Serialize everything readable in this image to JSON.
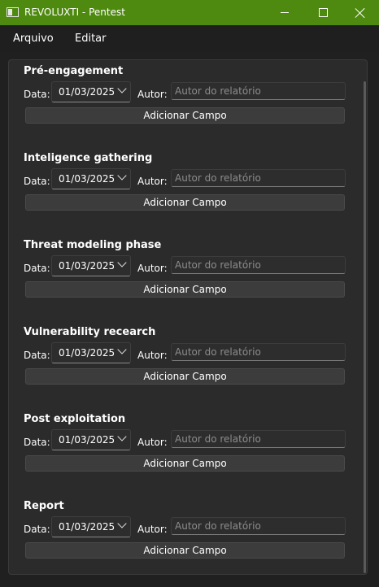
{
  "window": {
    "title": "REVOLUXTI - Pentest",
    "titlebar_color": "#4f8a10"
  },
  "menu": {
    "items": [
      "Arquivo",
      "Editar"
    ]
  },
  "phases": [
    {
      "title": "Pré-engagement",
      "date_label": "Data:",
      "date": "01/03/2025",
      "author_label": "Autor:",
      "author_placeholder": "Autor do relatório",
      "add_label": "Adicionar Campo"
    },
    {
      "title": "Inteligence gathering",
      "date_label": "Data:",
      "date": "01/03/2025",
      "author_label": "Autor:",
      "author_placeholder": "Autor do relatório",
      "add_label": "Adicionar Campo"
    },
    {
      "title": "Threat modeling phase",
      "date_label": "Data:",
      "date": "01/03/2025",
      "author_label": "Autor:",
      "author_placeholder": "Autor do relatório",
      "add_label": "Adicionar Campo"
    },
    {
      "title": "Vulnerability recearch",
      "date_label": "Data:",
      "date": "01/03/2025",
      "author_label": "Autor:",
      "author_placeholder": "Autor do relatório",
      "add_label": "Adicionar Campo"
    },
    {
      "title": "Post exploitation",
      "date_label": "Data:",
      "date": "01/03/2025",
      "author_label": "Autor:",
      "author_placeholder": "Autor do relatório",
      "add_label": "Adicionar Campo"
    },
    {
      "title": "Report",
      "date_label": "Data:",
      "date": "01/03/2025",
      "author_label": "Autor:",
      "author_placeholder": "Autor do relatório",
      "add_label": "Adicionar Campo"
    }
  ]
}
